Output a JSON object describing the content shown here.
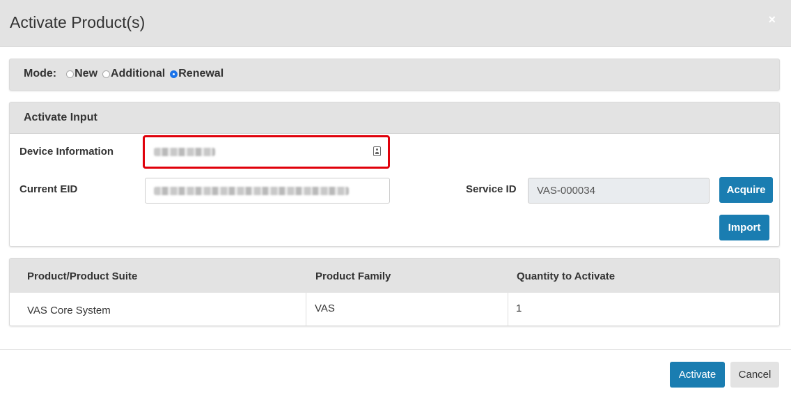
{
  "modal": {
    "title": "Activate Product(s)",
    "close_icon": "×"
  },
  "mode": {
    "label": "Mode:",
    "options": [
      {
        "label": "New",
        "checked": false
      },
      {
        "label": "Additional",
        "checked": false
      },
      {
        "label": "Renewal",
        "checked": true
      }
    ]
  },
  "activate_input": {
    "title": "Activate Input",
    "device_information_label": "Device Information",
    "current_eid_label": "Current EID",
    "service_id_label": "Service ID",
    "service_id_value": "VAS-000034",
    "acquire_label": "Acquire",
    "import_label": "Import"
  },
  "table": {
    "headers": [
      "Product/Product Suite",
      "Product Family",
      "Quantity to Activate"
    ],
    "rows": [
      [
        "VAS Core System",
        "VAS",
        "1"
      ]
    ]
  },
  "footer": {
    "activate_label": "Activate",
    "cancel_label": "Cancel"
  },
  "colors": {
    "primary": "#1a7db1",
    "highlight": "#e0000a",
    "header_bg": "#e3e3e3"
  },
  "icons": {
    "device_field": "contact-card-icon"
  }
}
